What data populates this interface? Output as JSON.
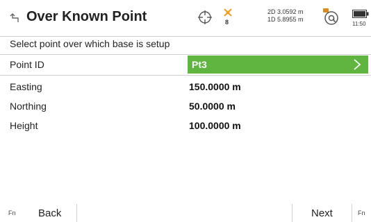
{
  "header": {
    "back_icon": "return-arrow-icon",
    "title": "Over Known Point",
    "satellite_count": "8",
    "quality_2d": "2D 3.0592 m",
    "quality_1d": "1D 5.8955 m",
    "time": "11:50"
  },
  "prompt": "Select point over which base is setup",
  "fields": {
    "point_id": {
      "label": "Point ID",
      "value": "Pt3"
    },
    "easting": {
      "label": "Easting",
      "value": "150.0000 m"
    },
    "northing": {
      "label": "Northing",
      "value": "50.0000 m"
    },
    "height": {
      "label": "Height",
      "value": "100.0000 m"
    }
  },
  "footer": {
    "fn_left": "Fn",
    "back_label": "Back",
    "next_label": "Next",
    "fn_right": "Fn"
  },
  "colors": {
    "selected_field": "#5fb53f",
    "satellite_icon": "#f0a020",
    "at_icon": "#e08a1e"
  }
}
